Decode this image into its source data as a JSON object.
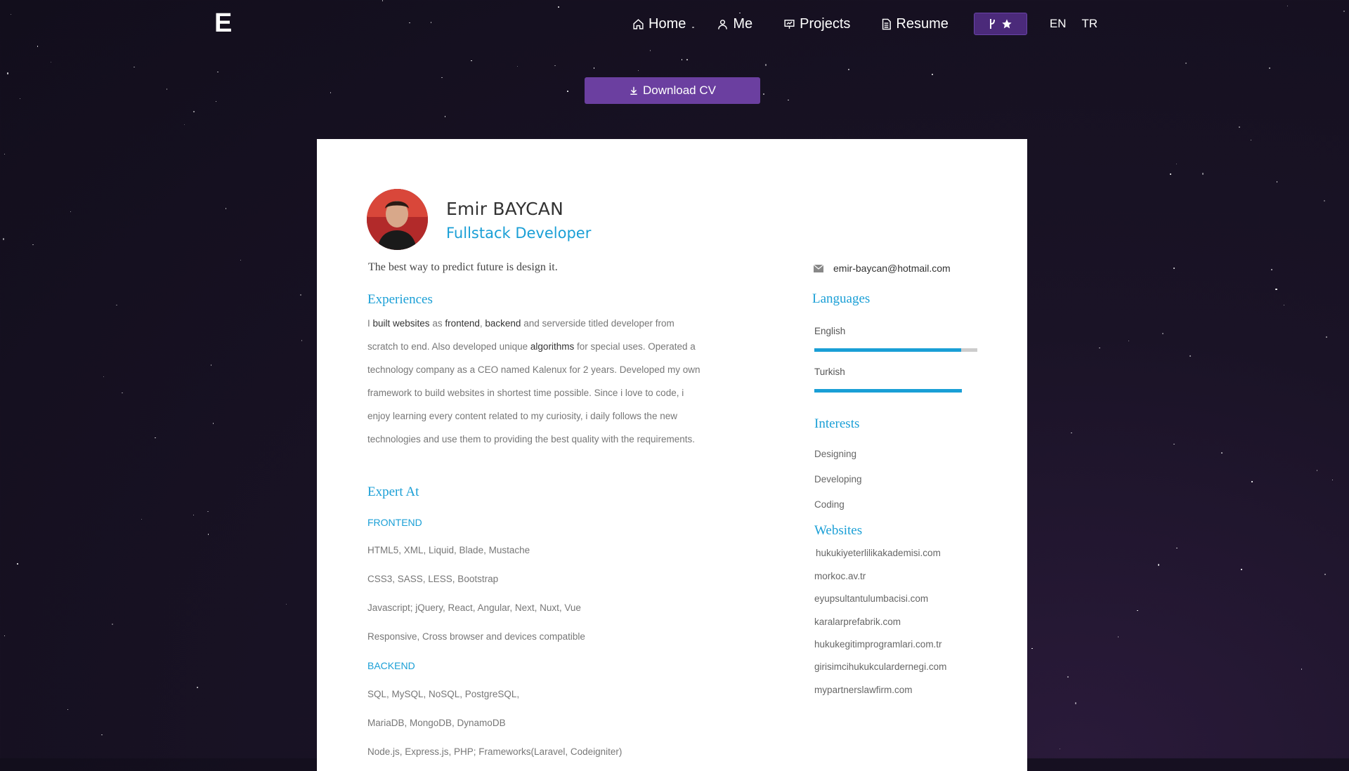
{
  "nav": {
    "logo": "E",
    "items": [
      {
        "label": "Home",
        "icon": "home-icon"
      },
      {
        "label": "Me",
        "icon": "user-icon"
      },
      {
        "label": "Projects",
        "icon": "presentation-icon"
      },
      {
        "label": "Resume",
        "icon": "document-icon"
      }
    ],
    "star_button_icons": [
      "fork-icon",
      "star-icon"
    ],
    "languages": [
      "EN",
      "TR"
    ]
  },
  "download": {
    "label": "Download CV",
    "icon": "download-icon"
  },
  "profile": {
    "name": "Emir BAYCAN",
    "title": "Fullstack Developer",
    "motto": "The best way to predict future is design it."
  },
  "experiences": {
    "heading": "Experiences",
    "text_parts": [
      {
        "t": "I ",
        "em": false
      },
      {
        "t": "built websites",
        "em": true
      },
      {
        "t": " as ",
        "em": false
      },
      {
        "t": "frontend",
        "em": true
      },
      {
        "t": ", ",
        "em": false
      },
      {
        "t": "backend",
        "em": true
      },
      {
        "t": " and serverside titled developer from scratch to end. Also developed unique ",
        "em": false
      },
      {
        "t": "algorithms",
        "em": true
      },
      {
        "t": " for special uses. Operated a technology company as a CEO named Kalenux for 2 years. Developed my own framework to build websites in shortest time possible. Since i love to code, i enjoy learning every content related to my curiosity, i daily follows the new technologies and use them to providing the best quality with the requirements.",
        "em": false
      }
    ]
  },
  "expert": {
    "heading": "Expert At",
    "frontend_label": "FRONTEND",
    "frontend": [
      "HTML5, XML, Liquid, Blade, Mustache",
      "CSS3, SASS, LESS, Bootstrap",
      "Javascript; jQuery, React, Angular, Next, Nuxt, Vue",
      "Responsive, Cross browser and devices compatible"
    ],
    "backend_label": "BACKEND",
    "backend": [
      "SQL, MySQL, NoSQL, PostgreSQL,",
      "MariaDB, MongoDB, DynamoDB",
      "Node.js, Express.js, PHP; Frameworks(Laravel, Codeigniter)"
    ]
  },
  "sidebar": {
    "email": "emir-baycan@hotmail.com",
    "languages_heading": "Languages",
    "languages": [
      {
        "name": "English",
        "level": 0.9
      },
      {
        "name": "Turkish",
        "level": 1.0
      }
    ],
    "interests_heading": "Interests",
    "interests": [
      "Designing",
      "Developing",
      "Coding"
    ],
    "websites_heading": "Websites",
    "websites": [
      "hukukiyeterlilikakademisi.com",
      "morkoc.av.tr",
      "eyupsultantulumbacisi.com",
      "karalarprefabrik.com",
      "hukukegitimprogramlari.com.tr",
      "girisimcihukukculardernegi.com",
      "mypartnerslawfirm.com"
    ]
  },
  "colors": {
    "accent": "#1a9fd6",
    "button": "#6b3fa0",
    "background": "#150f20"
  }
}
